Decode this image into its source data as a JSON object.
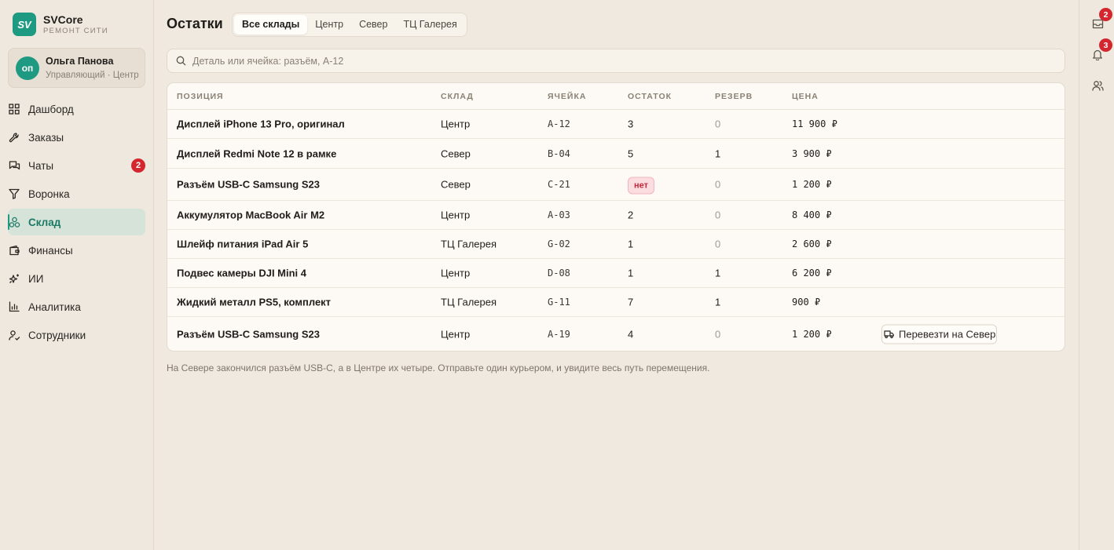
{
  "brand": {
    "logo": "SV",
    "name": "SVCore",
    "subtitle": "РЕМОНТ СИТИ"
  },
  "user": {
    "initials": "оп",
    "name": "Ольга Панова",
    "role": "Управляющий · Центр"
  },
  "nav": {
    "items": [
      {
        "label": "Дашборд",
        "icon": "dashboard-icon"
      },
      {
        "label": "Заказы",
        "icon": "wrench-icon"
      },
      {
        "label": "Чаты",
        "icon": "chat-icon",
        "badge": "2"
      },
      {
        "label": "Воронка",
        "icon": "funnel-icon"
      },
      {
        "label": "Склад",
        "icon": "warehouse-icon",
        "active": true
      },
      {
        "label": "Финансы",
        "icon": "wallet-icon"
      },
      {
        "label": "ИИ",
        "icon": "sparkles-icon"
      },
      {
        "label": "Аналитика",
        "icon": "bar-chart-icon"
      },
      {
        "label": "Сотрудники",
        "icon": "staff-icon"
      }
    ]
  },
  "page": {
    "title": "Остатки",
    "tabs": [
      "Все склады",
      "Центр",
      "Север",
      "ТЦ Галерея"
    ],
    "active_tab": "Все склады"
  },
  "search": {
    "placeholder": "Деталь или ячейка: разъём, А-12",
    "value": ""
  },
  "table": {
    "headers": [
      "ПОЗИЦИЯ",
      "СКЛАД",
      "ЯЧЕЙКА",
      "ОСТАТОК",
      "РЕЗЕРВ",
      "ЦЕНА"
    ],
    "rows": [
      {
        "name": "Дисплей iPhone 13 Pro, оригинал",
        "warehouse": "Центр",
        "cell": "A-12",
        "stock": "3",
        "reserve": "0",
        "price": "11 900 ₽"
      },
      {
        "name": "Дисплей Redmi Note 12 в рамке",
        "warehouse": "Север",
        "cell": "B-04",
        "stock": "5",
        "reserve": "1",
        "price": "3 900 ₽"
      },
      {
        "name": "Разъём USB-C Samsung S23",
        "warehouse": "Север",
        "cell": "C-21",
        "stock": "нет",
        "reserve": "0",
        "price": "1 200 ₽"
      },
      {
        "name": "Аккумулятор MacBook Air M2",
        "warehouse": "Центр",
        "cell": "A-03",
        "stock": "2",
        "reserve": "0",
        "price": "8 400 ₽"
      },
      {
        "name": "Шлейф питания iPad Air 5",
        "warehouse": "ТЦ Галерея",
        "cell": "G-02",
        "stock": "1",
        "reserve": "0",
        "price": "2 600 ₽"
      },
      {
        "name": "Подвес камеры DJI Mini 4",
        "warehouse": "Центр",
        "cell": "D-08",
        "stock": "1",
        "reserve": "1",
        "price": "6 200 ₽"
      },
      {
        "name": "Жидкий металл PS5, комплект",
        "warehouse": "ТЦ Галерея",
        "cell": "G-11",
        "stock": "7",
        "reserve": "1",
        "price": "900 ₽"
      },
      {
        "name": "Разъём USB-C Samsung S23",
        "warehouse": "Центр",
        "cell": "A-19",
        "stock": "4",
        "reserve": "0",
        "price": "1 200 ₽",
        "action": "Перевезти на Север"
      }
    ]
  },
  "hint": "На Севере закончился разъём USB-C, а в Центре их четыре. Отправьте один курьером, и увидите весь путь перемещения.",
  "rail": {
    "inbox_badge": "2",
    "notifications_badge": "3"
  },
  "colors": {
    "accent": "#1f9a82",
    "badge": "#d3262e",
    "background": "#f0e9e0"
  }
}
